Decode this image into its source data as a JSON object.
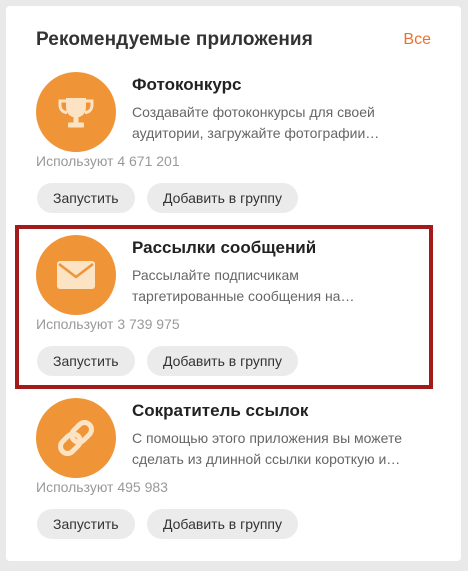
{
  "widget": {
    "title": "Рекомендуемые приложения",
    "all_link": "Все"
  },
  "apps": [
    {
      "title": "Фотоконкурс",
      "desc_line1": "Создавайте фотоконкурсы для своей",
      "desc_line2": "аудитории, загружайте фотографии…",
      "users": "Используют 4 671 201",
      "run_label": "Запустить",
      "add_label": "Добавить в группу",
      "icon": "trophy-icon"
    },
    {
      "title": "Рассылки сообщений",
      "desc_line1": "Рассылайте подписчикам",
      "desc_line2": "таргетированные сообщения на…",
      "users": "Используют 3 739 975",
      "run_label": "Запустить",
      "add_label": "Добавить в группу",
      "icon": "envelope-icon",
      "highlighted": true
    },
    {
      "title": "Сократитель ссылок",
      "desc_line1": "С помощью этого приложения вы можете",
      "desc_line2": "сделать из длинной ссылки короткую и…",
      "users": "Используют 495 983",
      "run_label": "Запустить",
      "add_label": "Добавить в группу",
      "icon": "link-icon"
    }
  ],
  "colors": {
    "accent": "#eb722e",
    "icon_bg": "#f09438",
    "highlight_border": "#a31a1a",
    "button_bg": "#ebebeb"
  }
}
